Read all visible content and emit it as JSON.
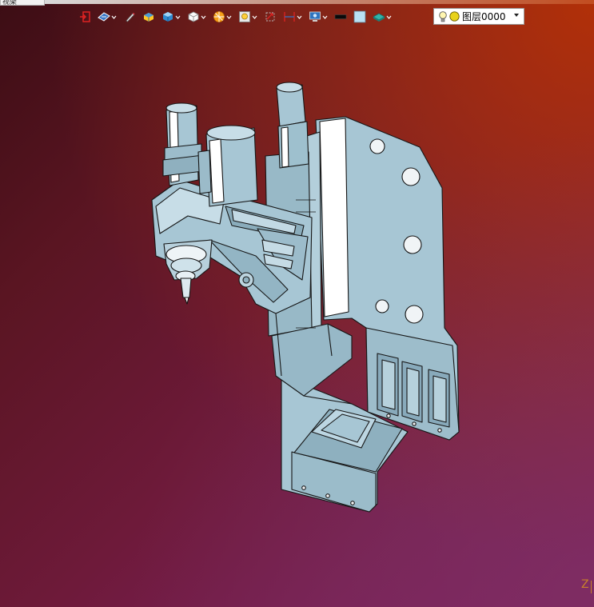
{
  "window": {
    "tab_label": "视架"
  },
  "toolbar": {
    "buttons": [
      {
        "icon": "exit-icon",
        "has_menu": false
      },
      {
        "icon": "view-direction-icon",
        "has_menu": true
      },
      {
        "icon": "pen-icon",
        "has_menu": false
      },
      {
        "icon": "shaded-solid-icon",
        "has_menu": false
      },
      {
        "icon": "shaded-cube-icon",
        "has_menu": true
      },
      {
        "icon": "wire-cube-icon",
        "has_menu": true
      },
      {
        "icon": "section-color-icon",
        "has_menu": true
      },
      {
        "icon": "zoom-window-icon",
        "has_menu": true
      },
      {
        "icon": "rotate-view-icon",
        "has_menu": false
      },
      {
        "icon": "dimension-icon",
        "has_menu": true
      },
      {
        "icon": "display-settings-icon",
        "has_menu": true
      },
      {
        "icon": "black-rectangle-icon",
        "has_menu": false
      },
      {
        "icon": "light-blue-square-icon",
        "has_menu": false
      },
      {
        "icon": "plane-icon",
        "has_menu": true
      }
    ],
    "layer": {
      "label": "图层0000",
      "colors": {
        "bulb": "#f5d418",
        "dot": "#e8d21a"
      }
    }
  },
  "viewport": {
    "axis_label": "Z",
    "colors": {
      "model_fill": "#a7c6d4",
      "model_edge": "#1a1a1a",
      "bg_dark": "#3c0d14",
      "bg_orange": "#b93500",
      "bg_purple": "#861a6e"
    }
  }
}
